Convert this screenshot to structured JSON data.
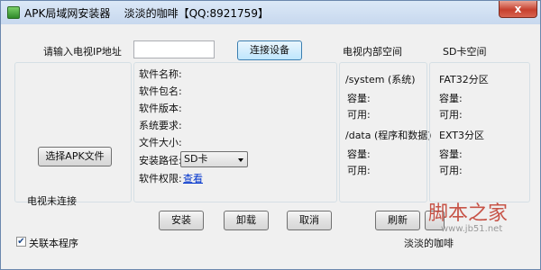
{
  "window": {
    "title": "APK局域网安装器    淡淡的咖啡【QQ:8921759】",
    "close_glyph": "x"
  },
  "connect": {
    "ip_label": "请输入电视IP地址",
    "ip_value": "",
    "connect_button": "连接设备"
  },
  "headers": {
    "internal_storage": "电视内部空间",
    "sd_storage": "SD卡空间"
  },
  "apk": {
    "select_button": "选择APK文件"
  },
  "software": {
    "name_label": "软件名称:",
    "package_label": "软件包名:",
    "version_label": "软件版本:",
    "requirement_label": "系统要求:",
    "size_label": "文件大小:",
    "install_path_label": "安装路径:",
    "install_path_value": "SD卡",
    "permission_label": "软件权限:",
    "permission_link": "查看"
  },
  "internal": {
    "system_title": "/system (系统)",
    "system_capacity_label": "容量:",
    "system_available_label": "可用:",
    "data_title": "/data (程序和数据)",
    "data_capacity_label": "容量:",
    "data_available_label": "可用:"
  },
  "sd": {
    "fat32_title": "FAT32分区",
    "fat32_capacity_label": "容量:",
    "fat32_available_label": "可用:",
    "ext3_title": "EXT3分区",
    "ext3_capacity_label": "容量:",
    "ext3_available_label": "可用:"
  },
  "status": {
    "connection": "电视未连接"
  },
  "actions": {
    "install": "安装",
    "uninstall": "卸载",
    "cancel": "取消",
    "refresh": "刷新",
    "extra": ""
  },
  "footer": {
    "associate_label": "关联本程序",
    "associate_checked": true,
    "author": "淡淡的咖啡"
  },
  "watermark": {
    "logo": "脚本之家",
    "url": "www.jb51.net"
  },
  "colors": {
    "title_bar": "#c7d8ee",
    "close_button": "#c6402e",
    "link": "#0033cc"
  }
}
